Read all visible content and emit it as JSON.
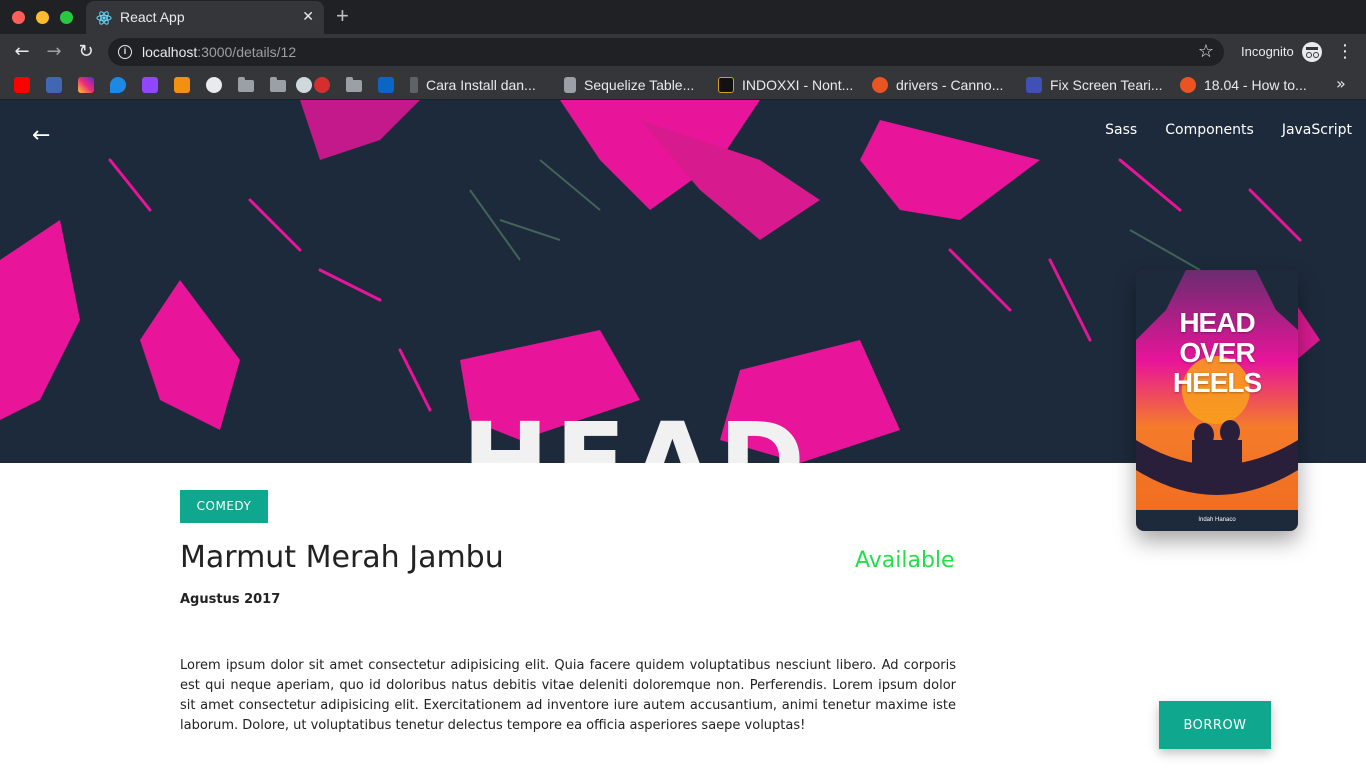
{
  "browser": {
    "tab_title": "React App",
    "tab_close": "✕",
    "new_tab": "+",
    "url_host": "localhost",
    "url_path": ":3000/details/12",
    "incognito_label": "Incognito",
    "bookmarks": [
      {
        "label": "Cara Install dan...",
        "icon": "page-icon"
      },
      {
        "label": "Sequelize Table...",
        "icon": "page-icon"
      },
      {
        "label": "INDOXXI - Nont...",
        "icon": "indoxxi-icon"
      },
      {
        "label": "drivers - Canno...",
        "icon": "ask-ubuntu-icon"
      },
      {
        "label": "Fix Screen Teari...",
        "icon": "h-icon"
      },
      {
        "label": "18.04 - How to...",
        "icon": "ask-ubuntu-icon"
      }
    ],
    "colors": {
      "chrome_dark": "#202124",
      "chrome_mid": "#35363a"
    }
  },
  "page": {
    "nav": [
      {
        "label": "Sass"
      },
      {
        "label": "Components"
      },
      {
        "label": "JavaScript"
      }
    ],
    "hero_text": "HEAD",
    "cover": {
      "title": "HEAD\nOVER\nHEELS",
      "author": "Indah Hanaco"
    },
    "genre": "COMEDY",
    "title": "Marmut Merah Jambu",
    "status": "Available",
    "date": "Agustus 2017",
    "description": "Lorem ipsum dolor sit amet consectetur adipisicing elit. Quia facere quidem voluptatibus nesciunt libero. Ad corporis est qui neque aperiam, quo id doloribus natus debitis vitae deleniti doloremque non. Perferendis. Lorem ipsum dolor sit amet consectetur adipisicing elit. Exercitationem ad inventore iure autem accusantium, animi tenetur maxime iste laborum. Dolore, ut voluptatibus tenetur delectus tempore ea officia asperiores saepe voluptas!",
    "borrow_label": "BORROW",
    "colors": {
      "accent": "#0fa88f",
      "status_available": "#22e04a",
      "hero_magenta": "#e8149a"
    }
  }
}
